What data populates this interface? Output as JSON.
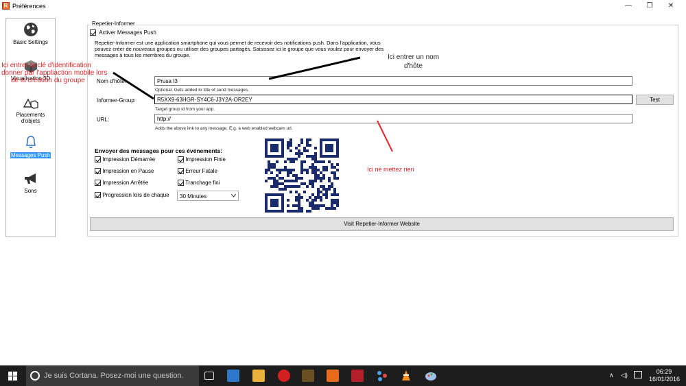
{
  "window": {
    "title": "Préférences",
    "app_icon_letter": "R",
    "minimize": "—",
    "maximize": "❐",
    "close": "✕"
  },
  "sidebar": {
    "items": [
      {
        "label": "Basic Settings",
        "icon": "globe-icon"
      },
      {
        "label": "Visualisation 3D",
        "icon": "cube-icon"
      },
      {
        "label": "Placements d'objets",
        "icon": "shapes-icon"
      },
      {
        "label": "Messages Push",
        "icon": "bell-icon",
        "active": true
      },
      {
        "label": "Sons",
        "icon": "megaphone-icon"
      }
    ]
  },
  "panel": {
    "group_title": "Repetier-Informer",
    "activate_label": "Activer Messages Push",
    "description": "Repetier-Informer est une application smartphone qui vous permet de recevoir des notifications push. Dans l'application, vous pouvez créer de nouveaux groupes ou utiliser des groupes partagés. Saisissez ici le groupe que vous voulez pour envoyer des messages à tous les membres du groupe.",
    "hostname_label": "Nom d'hôte:",
    "hostname_value": "Prusa I3",
    "hostname_hint": "Optional. Gets added to title of send messages.",
    "group_label": "Informer-Group:",
    "group_value": "R5XX9-63HGR-SY4C6-J3Y2A-OR2EY",
    "group_hint": "Target group id from your app.",
    "test_button": "Test",
    "url_label": "URL:",
    "url_value": "http://",
    "url_hint": "Adds the above link to any message. E.g. a web enabled webcam url.",
    "events_title": "Envoyer des messages pour ces événements:",
    "events": [
      {
        "label": "Impression Démarrée",
        "checked": true
      },
      {
        "label": "Impression Finie",
        "checked": true
      },
      {
        "label": "Impression en Pause",
        "checked": true
      },
      {
        "label": "Erreur Fatale",
        "checked": true
      },
      {
        "label": "Impression Arrêtée",
        "checked": true
      },
      {
        "label": "Tranchage fini",
        "checked": true
      }
    ],
    "progress_label": "Progression lors de chaque",
    "progress_select": "30 Minutes",
    "visit_button": "Visit Repetier-Informer Website"
  },
  "annotations": {
    "left_red": [
      "Ici entrer la clé d'identification",
      "donner par l'appliaction mobile lors",
      "de la création du groupe"
    ],
    "hostname_note": [
      "Ici entrer un nom",
      "d'hôte"
    ],
    "url_note": "Ici ne mettez rien",
    "red_color": "#e3262a"
  },
  "taskbar": {
    "cortana_placeholder": "Je suis Cortana. Posez-moi une question.",
    "time": "06:29",
    "date": "16/01/2016"
  },
  "colors": {
    "accent": "#3399ff",
    "taskbar": "#1d1d1d",
    "qr": "#1b2a6b"
  }
}
